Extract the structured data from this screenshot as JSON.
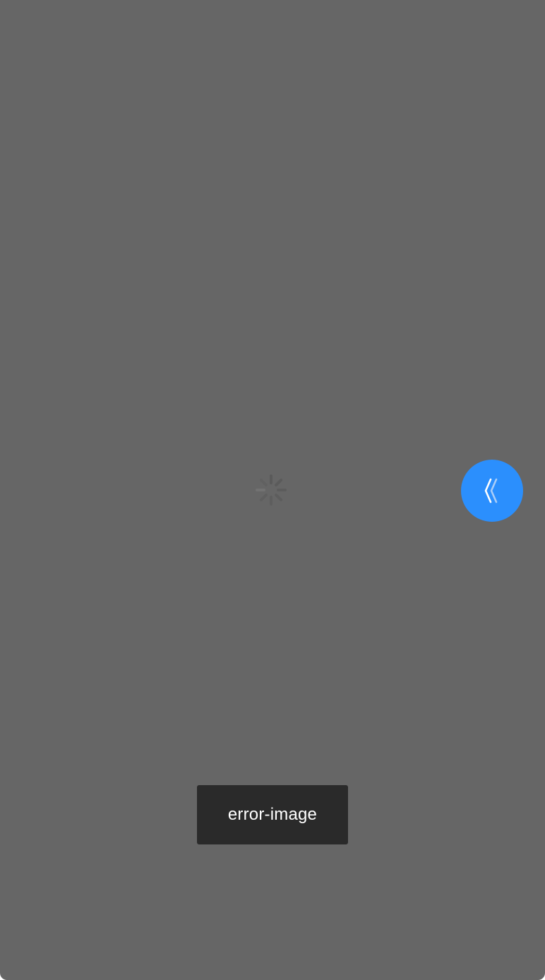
{
  "overlay": {
    "background": "#666666"
  },
  "spinner": {
    "icon": "loading-spinner-icon",
    "color": "#5a5a5a"
  },
  "float_button": {
    "icon": "double-chevron-left-icon",
    "background": "#2b8ffd"
  },
  "toast": {
    "message": "error-image",
    "background": "#2a2a2a"
  }
}
